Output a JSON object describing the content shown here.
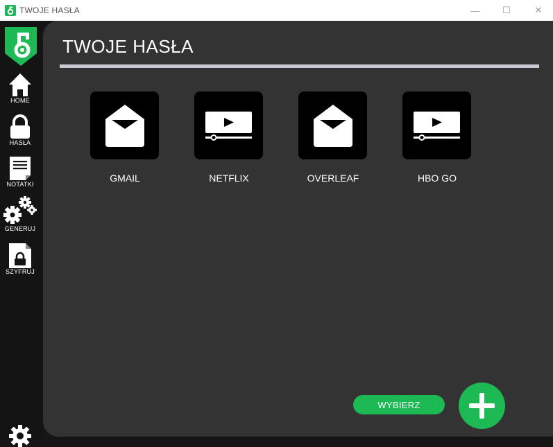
{
  "window": {
    "title": "TWOJE HASŁA",
    "minimize": "—",
    "maximize": "☐",
    "close": "✕"
  },
  "sidebar": {
    "items": [
      {
        "label": "HOME",
        "icon": "home-icon"
      },
      {
        "label": "HASŁA",
        "icon": "lock-icon"
      },
      {
        "label": "NOTATKI",
        "icon": "notes-icon"
      },
      {
        "label": "GENERUJ",
        "icon": "gears-icon"
      },
      {
        "label": "SZYFRUJ",
        "icon": "encrypted-file-icon"
      }
    ],
    "settings_icon": "gear-icon"
  },
  "main": {
    "title": "TWOJE HASŁA",
    "tiles": [
      {
        "label": "GMAIL",
        "icon": "mail-icon"
      },
      {
        "label": "NETFLIX",
        "icon": "video-icon"
      },
      {
        "label": "OVERLEAF",
        "icon": "mail-icon"
      },
      {
        "label": "HBO GO",
        "icon": "video-icon"
      }
    ],
    "pick_button": "WYBIERZ",
    "add_button_icon": "plus-icon"
  },
  "colors": {
    "accent": "#1db954",
    "sidebar": "#141414",
    "panel": "#333333",
    "tile": "#000000",
    "rule": "#c9c9d6"
  }
}
